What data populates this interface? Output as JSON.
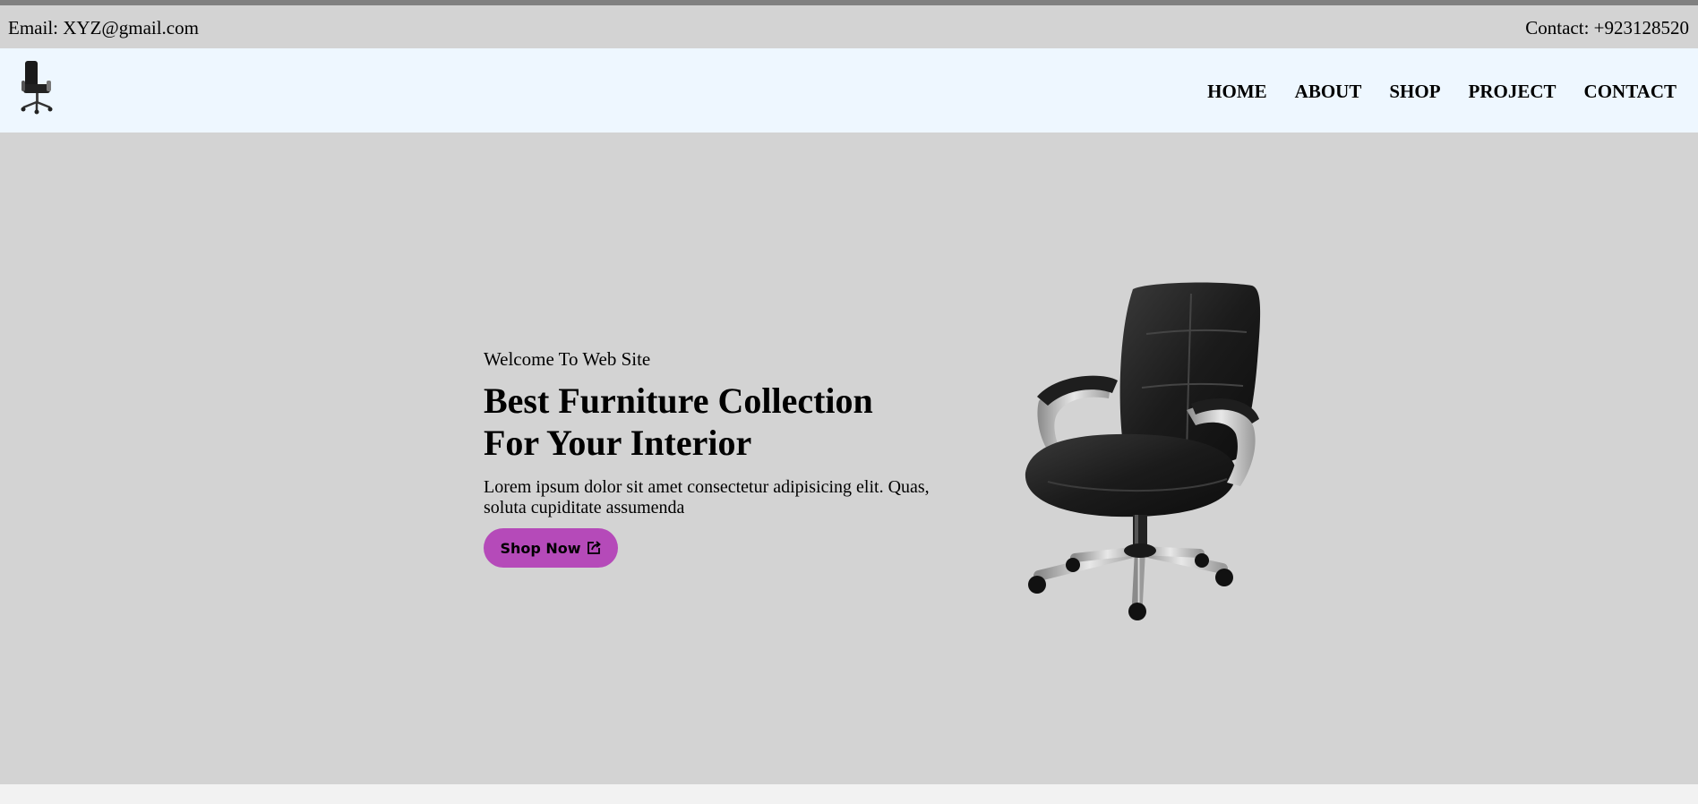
{
  "topbar": {
    "email": "Email: XYZ@gmail.com",
    "contact": "Contact: +923128520"
  },
  "logo": {
    "icon": "office-chair-icon"
  },
  "nav": {
    "items": [
      {
        "label": "HOME"
      },
      {
        "label": "ABOUT"
      },
      {
        "label": "SHOP"
      },
      {
        "label": "PROJECT"
      },
      {
        "label": "CONTACT"
      }
    ]
  },
  "hero": {
    "welcome": "Welcome To Web Site",
    "headline_line1": "Best Furniture Collection",
    "headline_line2": "For Your Interior",
    "description_line1": "Lorem ipsum dolor sit amet consectetur adipisicing elit. Quas,",
    "description_line2": "soluta cupiditate assumenda",
    "button_label": "Shop Now",
    "button_icon": "share-icon",
    "image": "office-chair-image"
  },
  "colors": {
    "topbar_bg": "#d3d3d3",
    "navbar_bg": "#eef7ff",
    "hero_bg": "#d3d3d3",
    "button_bg": "#b54ab9"
  }
}
